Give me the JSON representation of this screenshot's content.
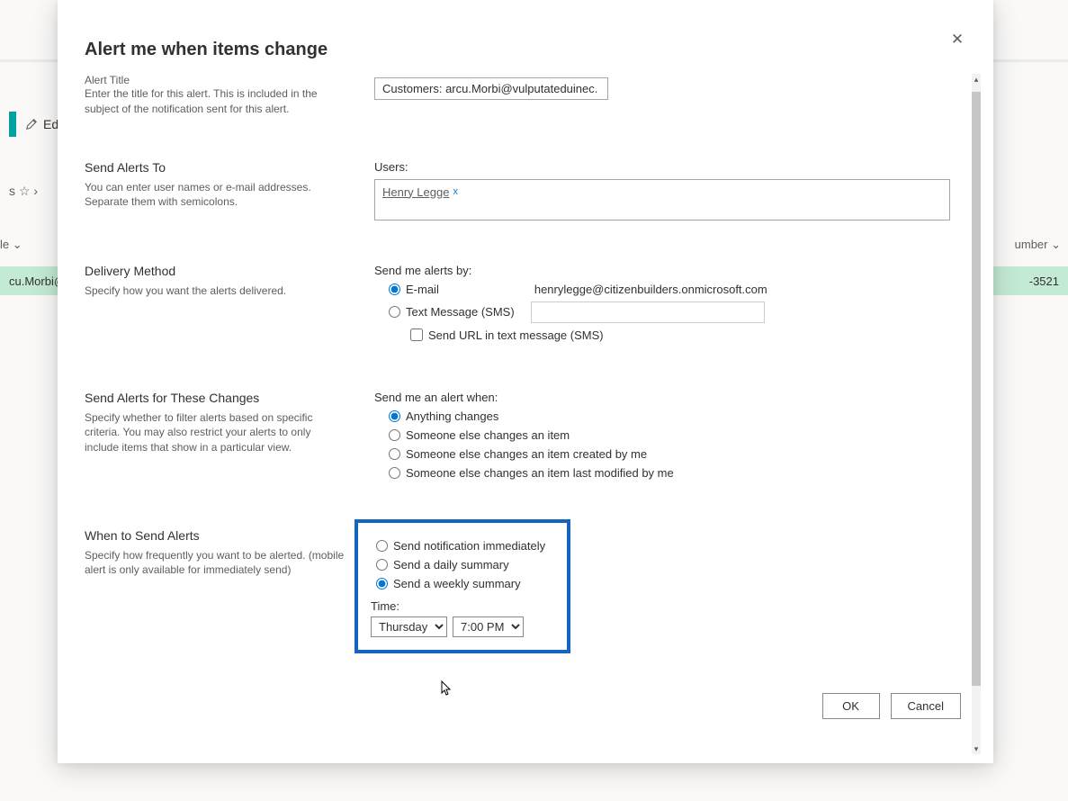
{
  "background": {
    "edit_label": "Edi",
    "star_row": "s ☆ ›",
    "le_text": "le ⌄",
    "number_label": "umber ⌄",
    "green_left": "cu.Morbi@",
    "green_right": "-3521"
  },
  "modal": {
    "title": "Alert me when items change",
    "close_icon": "✕"
  },
  "alert_title": {
    "cut_label": "Alert Title",
    "desc": "Enter the title for this alert. This is included in the subject of the notification sent for this alert.",
    "value": "Customers: arcu.Morbi@vulputateduinec."
  },
  "send_to": {
    "title": "Send Alerts To",
    "desc": "You can enter user names or e-mail addresses. Separate them with semicolons.",
    "users_label": "Users:",
    "user_name": "Henry Legge",
    "remove_icon": "x"
  },
  "delivery": {
    "title": "Delivery Method",
    "desc": "Specify how you want the alerts delivered.",
    "send_by_label": "Send me alerts by:",
    "email_label": "E-mail",
    "email_value": "henrylegge@citizenbuilders.onmicrosoft.com",
    "sms_label": "Text Message (SMS)",
    "send_url_label": "Send URL in text message (SMS)"
  },
  "changes": {
    "title": "Send Alerts for These Changes",
    "desc": "Specify whether to filter alerts based on specific criteria. You may also restrict your alerts to only include items that show in a particular view.",
    "send_when_label": "Send me an alert when:",
    "opt_anything": "Anything changes",
    "opt_else": "Someone else changes an item",
    "opt_created": "Someone else changes an item created by me",
    "opt_modified": "Someone else changes an item last modified by me"
  },
  "when": {
    "title": "When to Send Alerts",
    "desc": "Specify how frequently you want to be alerted. (mobile alert is only available for immediately send)",
    "opt_immediate": "Send notification immediately",
    "opt_daily": "Send a daily summary",
    "opt_weekly": "Send a weekly summary",
    "time_label": "Time:",
    "day_value": "Thursday",
    "time_value": "7:00 PM"
  },
  "footer": {
    "ok": "OK",
    "cancel": "Cancel"
  }
}
